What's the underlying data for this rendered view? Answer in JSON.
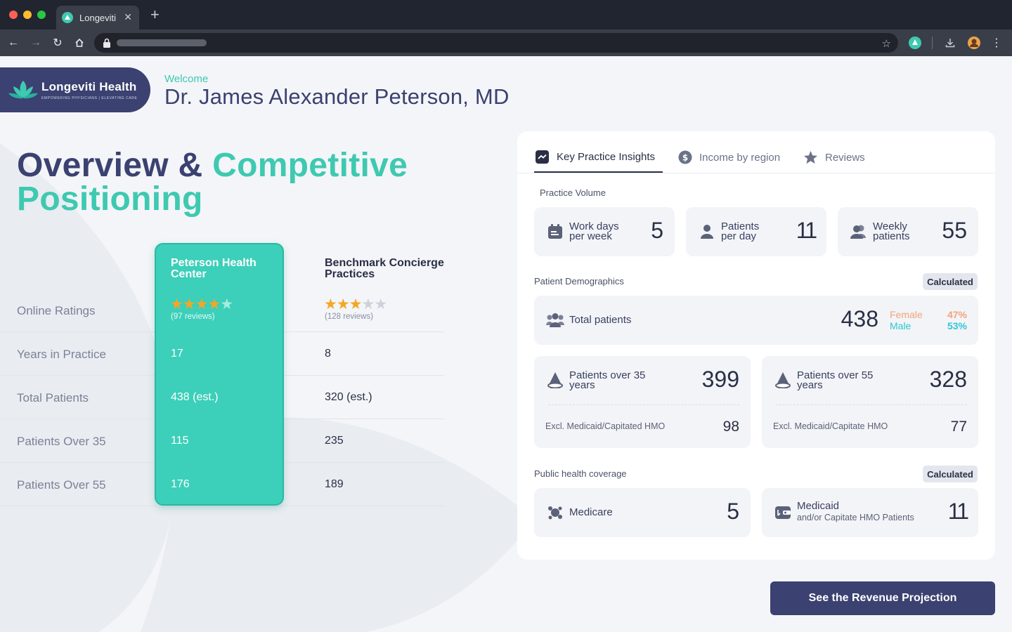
{
  "browser": {
    "tab_title": "Longeviti",
    "colors": {
      "close": "#ff5f57",
      "minimize": "#febc2e",
      "maximize": "#28c840"
    }
  },
  "brand": {
    "name": "Longeviti Health",
    "tagline": "EMPOWERING PHYSICIANS | ELEVATING CARE"
  },
  "header": {
    "welcome": "Welcome",
    "doctor_name": "Dr. James Alexander Peterson, MD"
  },
  "title": {
    "part1": "Overview & ",
    "part2": "Competitive",
    "part3": "Positioning"
  },
  "comparison": {
    "highlight_title": "Peterson Health Center",
    "benchmark_title": "Benchmark Concierge Practices",
    "rows": [
      {
        "label": "Online Ratings",
        "highlight": "",
        "benchmark": ""
      },
      {
        "label": "Years in Practice",
        "highlight": "17",
        "benchmark": "8"
      },
      {
        "label": "Total Patients",
        "highlight": "438 (est.)",
        "benchmark": "320 (est.)"
      },
      {
        "label": "Patients Over 35",
        "highlight": "115",
        "benchmark": "235"
      },
      {
        "label": "Patients Over 55",
        "highlight": "176",
        "benchmark": "189"
      }
    ],
    "highlight_rating": {
      "stars": 4,
      "out_of": 5,
      "reviews": "(97 reviews)"
    },
    "benchmark_rating": {
      "stars": 3,
      "out_of": 5,
      "reviews": "(128 reviews)"
    }
  },
  "panel": {
    "tabs": [
      {
        "label": "Key Practice Insights",
        "icon": "trend-icon",
        "active": true
      },
      {
        "label": "Income by region",
        "icon": "dollar-icon",
        "active": false
      },
      {
        "label": "Reviews",
        "icon": "star-icon",
        "active": false
      }
    ],
    "practice_volume": {
      "title": "Practice Volume",
      "items": [
        {
          "label_line1": "Work days",
          "label_line2": "per week",
          "value": "5"
        },
        {
          "label_line1": "Patients",
          "label_line2": "per day",
          "value": "11"
        },
        {
          "label_line1": "Weekly",
          "label_line2": "patients",
          "value": "55"
        }
      ]
    },
    "demographics": {
      "title": "Patient Demographics",
      "badge": "Calculated",
      "total_label": "Total patients",
      "total_value": "438",
      "female_label": "Female",
      "female_pct": "47%",
      "male_label": "Male",
      "male_pct": "53%",
      "over35": {
        "label_line1": "Patients over 35",
        "label_line2": "years",
        "value": "399",
        "sub_label": "Excl. Medicaid/Capitated HMO",
        "sub_value": "98"
      },
      "over55": {
        "label_line1": "Patients over 55",
        "label_line2": "years",
        "value": "328",
        "sub_label": "Excl. Medicaid/Capitate HMO",
        "sub_value": "77"
      }
    },
    "coverage": {
      "title": "Public health coverage",
      "badge": "Calculated",
      "medicare": {
        "label": "Medicare",
        "value": "5"
      },
      "medicaid": {
        "label": "Medicaid",
        "sub_label": "and/or Capitate HMO Patients",
        "value": "11"
      }
    },
    "colors": {
      "accent": "#3ec9b1",
      "navy": "#3b4170",
      "female": "#f5a27a",
      "male": "#2fc6d6"
    }
  },
  "cta": {
    "label": "See the Revenue Projection"
  }
}
